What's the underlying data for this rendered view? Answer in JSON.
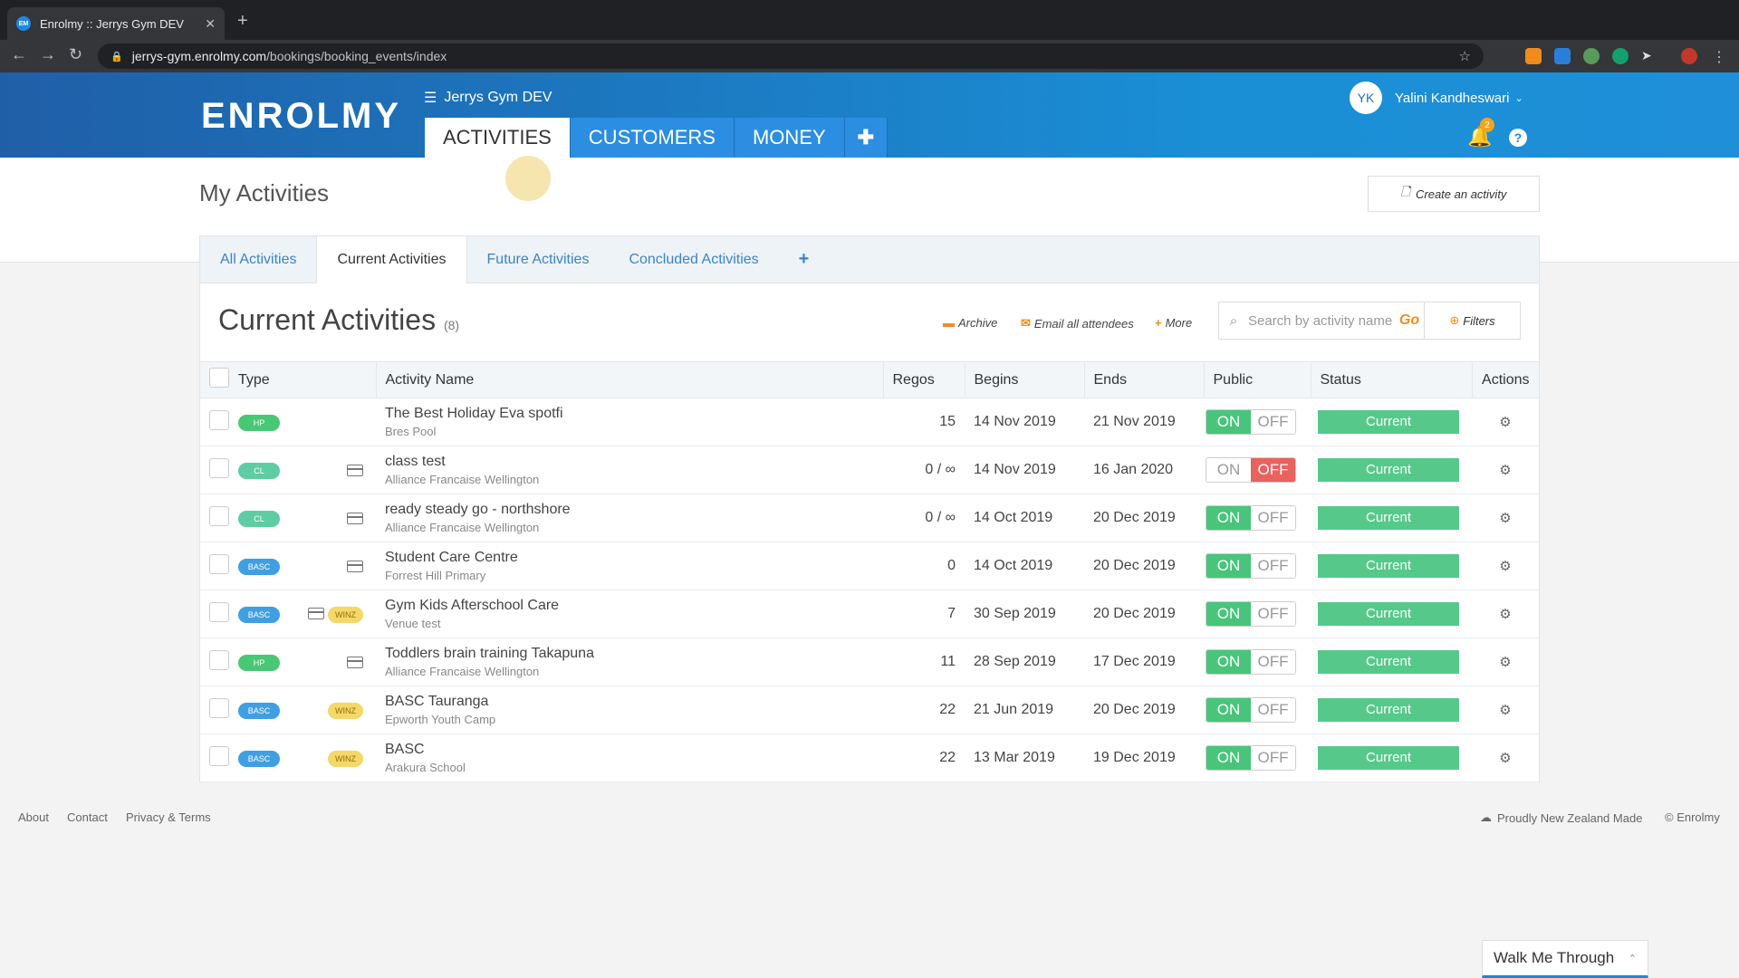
{
  "browser": {
    "tab_title": "Enrolmy :: Jerrys Gym DEV",
    "tab_favicon": "EM",
    "url_host": "jerrys-gym.enrolmy.com",
    "url_path": "/bookings/booking_events/index"
  },
  "header": {
    "logo": "ENROLMY",
    "org_name": "Jerrys Gym DEV",
    "nav_tabs": [
      "ACTIVITIES",
      "CUSTOMERS",
      "MONEY"
    ],
    "user_initials": "YK",
    "user_name": "Yalini Kandheswari",
    "notification_count": "2",
    "help": "?"
  },
  "page": {
    "title": "My Activities",
    "create_button": "Create an activity"
  },
  "subtabs": [
    "All Activities",
    "Current Activities",
    "Future Activities",
    "Concluded Activities"
  ],
  "panel": {
    "title": "Current Activities",
    "count": "(8)",
    "archive": "Archive",
    "email_all": "Email all attendees",
    "more": "More",
    "search_placeholder": "Search by activity name",
    "go": "Go",
    "filters": "Filters"
  },
  "columns": [
    "Type",
    "Activity Name",
    "Regos",
    "Begins",
    "Ends",
    "Public",
    "Status",
    "Actions"
  ],
  "rows": [
    {
      "type": "HP",
      "card": false,
      "winz": false,
      "name": "The Best Holiday Eva spotfi",
      "venue": "Bres Pool",
      "regos": "15",
      "begins": "14 Nov 2019",
      "ends": "21 Nov 2019",
      "public": "on",
      "status": "Current"
    },
    {
      "type": "CL",
      "card": true,
      "winz": false,
      "name": "class test",
      "venue": "Alliance Francaise Wellington",
      "regos": "0 / ∞",
      "begins": "14 Nov 2019",
      "ends": "16 Jan 2020",
      "public": "off",
      "status": "Current"
    },
    {
      "type": "CL",
      "card": true,
      "winz": false,
      "name": "ready steady go - northshore",
      "venue": "Alliance Francaise Wellington",
      "regos": "0 / ∞",
      "begins": "14 Oct 2019",
      "ends": "20 Dec 2019",
      "public": "on",
      "status": "Current"
    },
    {
      "type": "BASC",
      "card": true,
      "winz": false,
      "name": "Student Care Centre",
      "venue": "Forrest Hill Primary",
      "regos": "0",
      "begins": "14 Oct 2019",
      "ends": "20 Dec 2019",
      "public": "on",
      "status": "Current"
    },
    {
      "type": "BASC",
      "card": true,
      "winz": true,
      "name": "Gym Kids Afterschool Care",
      "venue": "Venue test",
      "regos": "7",
      "begins": "30 Sep 2019",
      "ends": "20 Dec 2019",
      "public": "on",
      "status": "Current"
    },
    {
      "type": "HP",
      "card": true,
      "winz": false,
      "name": "Toddlers brain training Takapuna",
      "venue": "Alliance Francaise Wellington",
      "regos": "11",
      "begins": "28 Sep 2019",
      "ends": "17 Dec 2019",
      "public": "on",
      "status": "Current"
    },
    {
      "type": "BASC",
      "card": false,
      "winz": true,
      "name": "BASC Tauranga",
      "venue": "Epworth Youth Camp",
      "regos": "22",
      "begins": "21 Jun 2019",
      "ends": "20 Dec 2019",
      "public": "on",
      "status": "Current"
    },
    {
      "type": "BASC",
      "card": false,
      "winz": true,
      "name": "BASC",
      "venue": "Arakura School",
      "regos": "22",
      "begins": "13 Mar 2019",
      "ends": "19 Dec 2019",
      "public": "on",
      "status": "Current"
    }
  ],
  "toggle_labels": {
    "on": "ON",
    "off": "OFF"
  },
  "winz_label": "WINZ",
  "footer": {
    "links": [
      "About",
      "Contact",
      "Privacy & Terms"
    ],
    "nz_made": "Proudly New Zealand Made",
    "copyright": "© Enrolmy"
  },
  "walkme": "Walk Me Through",
  "colors": {
    "header_start": "#1f5fa8",
    "header_end": "#1a8fd6",
    "accent_orange": "#f08c1c",
    "status_green": "#56c98a",
    "toggle_off_red": "#e8625e"
  }
}
